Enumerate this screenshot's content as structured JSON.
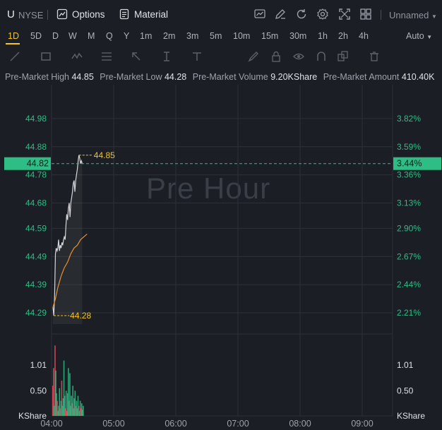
{
  "header": {
    "ticker": "U",
    "exchange": "NYSE",
    "options_label": "Options",
    "material_label": "Material",
    "layout_label": "Unnamed",
    "right_icons": [
      "chart-icon",
      "pen-icon",
      "refresh-icon",
      "settings-gear-icon",
      "fullscreen-icon",
      "grid-icon"
    ]
  },
  "timeframes": {
    "items": [
      "1D",
      "5D",
      "D",
      "W",
      "M",
      "Q",
      "Y",
      "1m",
      "2m",
      "3m",
      "5m",
      "10m",
      "15m",
      "30m",
      "1h",
      "2h",
      "4h"
    ],
    "active": "1D",
    "auto_label": "Auto"
  },
  "drawing_tools": [
    "line-tool-icon",
    "rectangle-tool-icon",
    "wave-tool-icon",
    "fibonacci-tool-icon",
    "arrow-tool-icon",
    "measure-tool-icon",
    "text-tool-icon",
    "brush-icon",
    "lock-icon",
    "eye-icon",
    "magnet-icon",
    "copy-icon",
    "trash-icon"
  ],
  "premarket": {
    "high_label": "Pre-Market High",
    "high_value": "44.85",
    "low_label": "Pre-Market Low",
    "low_value": "44.28",
    "volume_label": "Pre-Market Volume",
    "volume_value": "9.20KShare",
    "amount_label": "Pre-Market Amount",
    "amount_value": "410.40K"
  },
  "watermark": "Pre Hour",
  "colors": {
    "up": "#2ebd85",
    "down": "#f6465d",
    "accent": "#f5c518",
    "avg_line": "#e8912c",
    "price_line": "#d6d8dc",
    "grid": "#2c3038"
  },
  "chart_data": {
    "type": "line",
    "price_axis": {
      "left_ticks": [
        "44.98",
        "44.88",
        "44.78",
        "44.68",
        "44.59",
        "44.49",
        "44.39",
        "44.29"
      ],
      "right_ticks": [
        "3.82%",
        "3.59%",
        "3.36%",
        "3.13%",
        "2.90%",
        "2.67%",
        "2.44%",
        "2.21%"
      ],
      "ylim": [
        44.25,
        45.05
      ]
    },
    "current_price": "44.82",
    "current_change": "3.44%",
    "high_marker": "44.85",
    "low_marker": "44.28",
    "volume_axis": {
      "ticks_left": [
        "1.01",
        "0.50"
      ],
      "ticks_right": [
        "1.01",
        "0.50"
      ],
      "unit_left": "KShare",
      "unit_right": "KShare",
      "ylim": [
        0,
        1.6
      ]
    },
    "x_ticks": [
      "04:00",
      "05:00",
      "06:00",
      "07:00",
      "08:00",
      "09:00"
    ],
    "x_range_minutes": [
      0,
      330
    ],
    "price_series": {
      "name": "price",
      "x": [
        0,
        1,
        2,
        3,
        4,
        5,
        6,
        7,
        8,
        9,
        10,
        11,
        12,
        13,
        14,
        15,
        16,
        17,
        18,
        19,
        20,
        21,
        22,
        23,
        24,
        25,
        26,
        27,
        28,
        29,
        30,
        31,
        32,
        33,
        34,
        35,
        36
      ],
      "y": [
        44.31,
        44.28,
        44.35,
        44.5,
        44.52,
        44.51,
        44.52,
        44.55,
        44.51,
        44.53,
        44.52,
        44.54,
        44.53,
        44.55,
        44.56,
        44.55,
        44.6,
        44.64,
        44.62,
        44.66,
        44.68,
        44.63,
        44.68,
        44.7,
        44.72,
        44.75,
        44.76,
        44.72,
        44.76,
        44.78,
        44.8,
        44.83,
        44.85,
        44.84,
        44.82,
        44.83,
        44.82
      ]
    },
    "avg_series": {
      "name": "average",
      "x": [
        0,
        3,
        6,
        10,
        14,
        18,
        22,
        26,
        30,
        34,
        38,
        42
      ],
      "y": [
        44.31,
        44.34,
        44.38,
        44.42,
        44.45,
        44.47,
        44.5,
        44.52,
        44.53,
        44.55,
        44.56,
        44.57
      ]
    },
    "volume": {
      "x": [
        0,
        1,
        2,
        3,
        4,
        5,
        6,
        7,
        8,
        9,
        10,
        11,
        12,
        13,
        14,
        15,
        16,
        17,
        18,
        19,
        20,
        21,
        22,
        23,
        24,
        25,
        26,
        27,
        28,
        29,
        30,
        31,
        32,
        33,
        34,
        35,
        36,
        37,
        38,
        39,
        40,
        41
      ],
      "values": [
        0.6,
        0.95,
        0.2,
        1.4,
        0.9,
        0.45,
        0.3,
        0.1,
        0.2,
        0.55,
        0.15,
        0.3,
        0.7,
        0.2,
        0.35,
        1.1,
        0.4,
        0.15,
        0.5,
        0.1,
        0.45,
        0.95,
        0.3,
        0.85,
        0.2,
        0.4,
        0.25,
        0.6,
        0.15,
        0.35,
        0.5,
        0.2,
        0.3,
        0.15,
        0.4,
        0.2,
        0.1,
        0.3,
        0.15,
        0.25,
        0.12,
        0.2
      ],
      "up": [
        0,
        0,
        1,
        0,
        1,
        1,
        0,
        1,
        1,
        1,
        0,
        1,
        0,
        1,
        1,
        1,
        1,
        0,
        1,
        0,
        1,
        1,
        0,
        1,
        1,
        1,
        0,
        1,
        1,
        1,
        1,
        0,
        1,
        1,
        1,
        0,
        1,
        1,
        0,
        1,
        1,
        1
      ]
    }
  }
}
